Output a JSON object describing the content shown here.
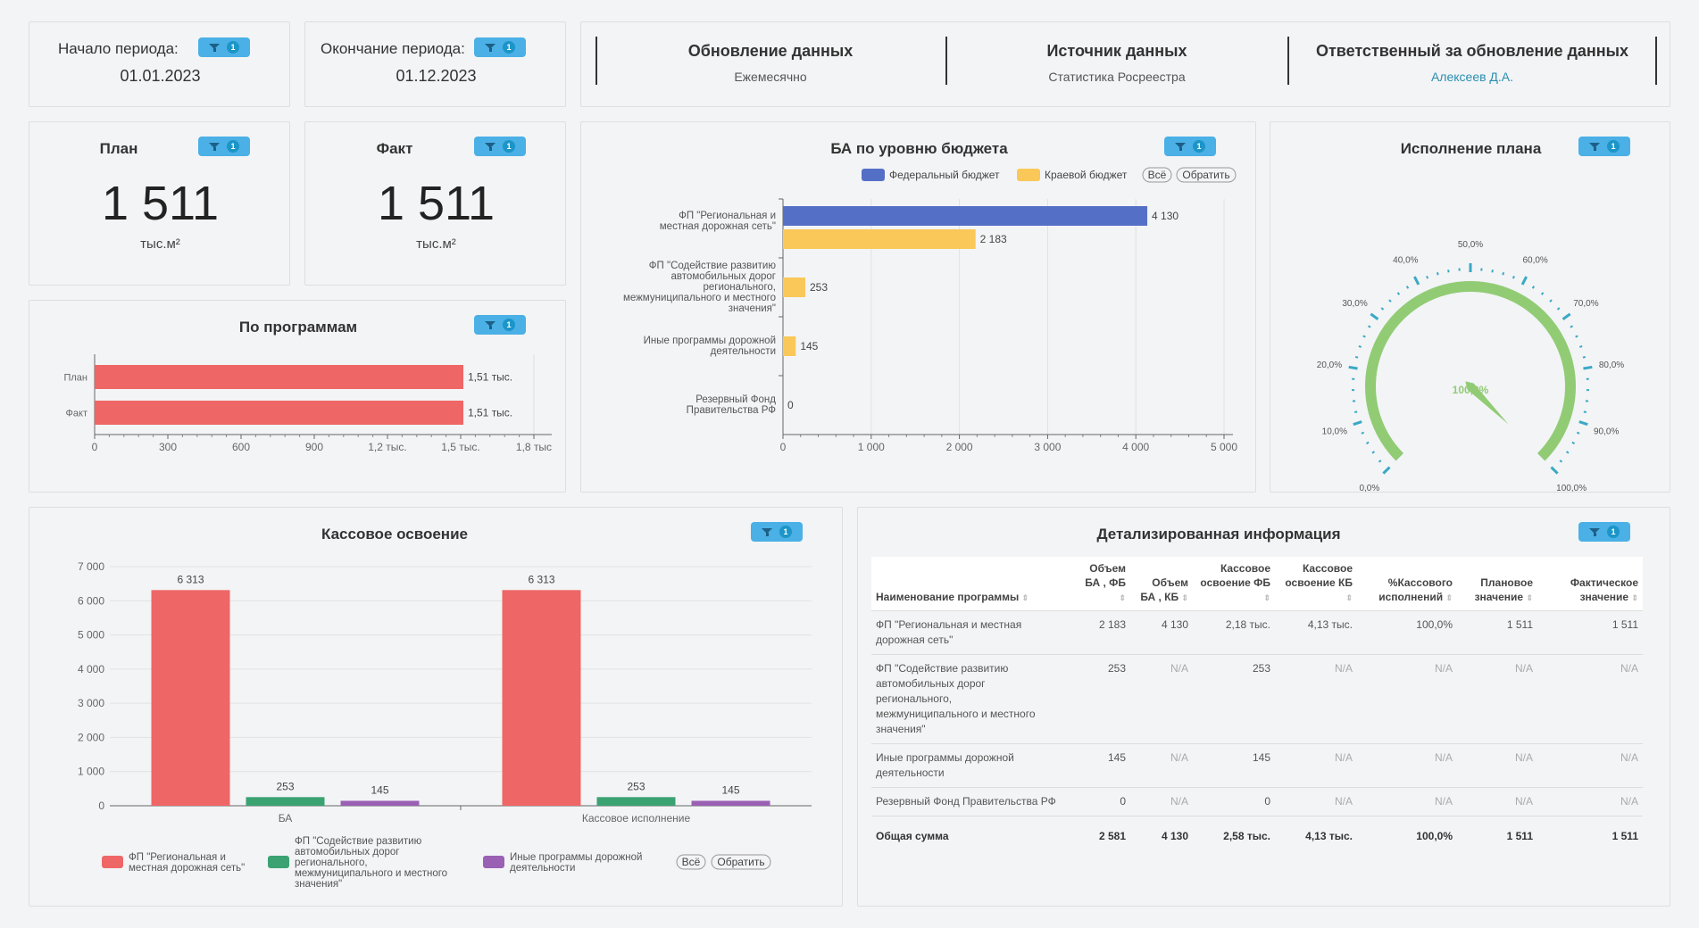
{
  "period": {
    "start_label": "Начало периода:",
    "start_value": "01.01.2023",
    "end_label": "Окончание периода:",
    "end_value": "01.12.2023"
  },
  "filter_count": "1",
  "info": {
    "update_title": "Обновление данных",
    "update_value": "Ежемесячно",
    "source_title": "Источник данных",
    "source_value": "Статистика Росреестра",
    "resp_title": "Ответственный за обновление данных",
    "resp_value": "Алексеев Д.А."
  },
  "plan": {
    "title": "План",
    "value": "1 511",
    "unit": "тыс.м²"
  },
  "fact": {
    "title": "Факт",
    "value": "1 511",
    "unit": "тыс.м²"
  },
  "colors": {
    "red": "#ee6666",
    "blue": "#5470c6",
    "yellow": "#fac858",
    "green": "#3ba272",
    "purple": "#9a60b4",
    "gauge": "#91cc75",
    "tick": "#3aa9c4"
  },
  "chart_data": [
    {
      "type": "bar",
      "title": "По программам",
      "orientation": "horizontal",
      "categories": [
        "План",
        "Факт"
      ],
      "values": [
        1511,
        1511
      ],
      "data_labels": [
        "1,51 тыс.",
        "1,51 тыс."
      ],
      "xlim": [
        0,
        1800
      ],
      "x_ticks": [
        "0",
        "300",
        "600",
        "900",
        "1,2 тыс.",
        "1,5 тыс.",
        "1,8 тыс"
      ]
    },
    {
      "type": "bar",
      "title": "БА по уровню бюджета",
      "orientation": "horizontal",
      "categories": [
        "ФП \"Региональная и местная дорожная сеть\"",
        "ФП \"Содействие развитию автомобильных дорог регионального, межмуниципального и местного значения\"",
        "Иные программы дорожной деятельности",
        "Резервный Фонд Правительства РФ"
      ],
      "series": [
        {
          "name": "Федеральный бюджет",
          "values": [
            4130,
            null,
            null,
            null
          ]
        },
        {
          "name": "Краевой бюджет",
          "values": [
            2183,
            253,
            145,
            0
          ]
        }
      ],
      "xlim": [
        0,
        5000
      ],
      "x_ticks": [
        "0",
        "1 000",
        "2 000",
        "3 000",
        "4 000",
        "5 000"
      ],
      "legend_buttons": [
        "Всё",
        "Обратить"
      ]
    },
    {
      "type": "gauge",
      "title": "Исполнение плана",
      "value": 100,
      "value_label": "100,0%",
      "range": [
        0,
        100
      ],
      "tick_labels": [
        "0,0%",
        "10,0%",
        "20,0%",
        "30,0%",
        "40,0%",
        "50,0%",
        "60,0%",
        "70,0%",
        "80,0%",
        "90,0%",
        "100,0%"
      ]
    },
    {
      "type": "bar",
      "title": "Кассовое освоение",
      "categories": [
        "БА",
        "Кассовое исполнение"
      ],
      "series": [
        {
          "name": "ФП \"Региональная и местная дорожная сеть\"",
          "values": [
            6313,
            6313
          ]
        },
        {
          "name": "ФП \"Содействие развитию автомобильных дорог регионального, межмуниципального и местного значения\"",
          "values": [
            253,
            253
          ]
        },
        {
          "name": "Иные программы дорожной деятельности",
          "values": [
            145,
            145
          ]
        }
      ],
      "ylim": [
        0,
        7000
      ],
      "y_ticks": [
        "0",
        "1 000",
        "2 000",
        "3 000",
        "4 000",
        "5 000",
        "6 000",
        "7 000"
      ],
      "legend_buttons": [
        "Всё",
        "Обратить"
      ]
    }
  ],
  "table": {
    "title": "Детализированная информация",
    "headers": [
      "Наименование программы",
      "Объем БА , ФБ",
      "Объем БА , КБ",
      "Кассовое освоение ФБ",
      "Кассовое освоение КБ",
      "%Кассового исполнений",
      "Плановое значение",
      "Фактическое значение"
    ],
    "rows": [
      [
        "ФП \"Региональная и местная дорожная сеть\"",
        "2 183",
        "4 130",
        "2,18 тыс.",
        "4,13 тыс.",
        "100,0%",
        "1 511",
        "1 511"
      ],
      [
        "ФП \"Содействие развитию автомобильных дорог регионального, межмуниципального и местного значения\"",
        "253",
        "N/A",
        "253",
        "N/A",
        "N/A",
        "N/A",
        "N/A"
      ],
      [
        "Иные программы дорожной деятельности",
        "145",
        "N/A",
        "145",
        "N/A",
        "N/A",
        "N/A",
        "N/A"
      ],
      [
        "Резервный Фонд Правительства РФ",
        "0",
        "N/A",
        "0",
        "N/A",
        "N/A",
        "N/A",
        "N/A"
      ]
    ],
    "total": [
      "Общая сумма",
      "2 581",
      "4 130",
      "2,58 тыс.",
      "4,13 тыс.",
      "100,0%",
      "1 511",
      "1 511"
    ]
  }
}
